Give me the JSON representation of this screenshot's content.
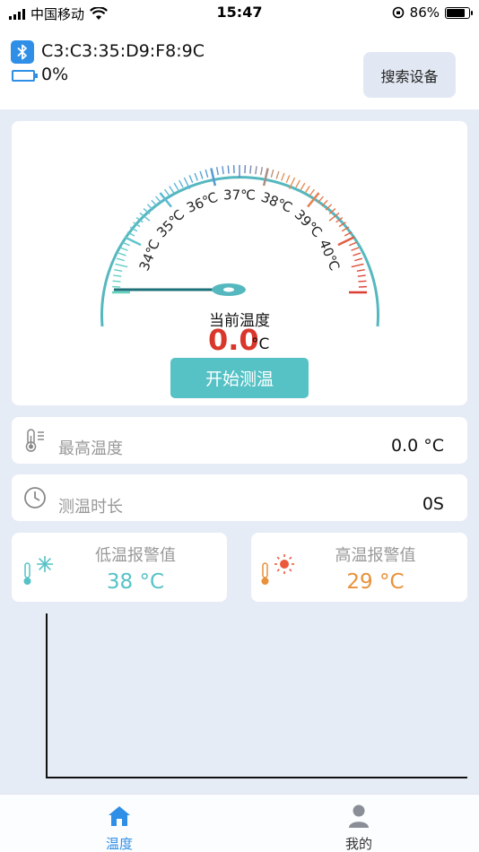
{
  "status_bar": {
    "carrier": "中国移动",
    "time": "15:47",
    "battery_pct": "86%"
  },
  "device": {
    "mac": "C3:C3:35:D9:F8:9C",
    "battery": "0%",
    "search_button": "搜索设备"
  },
  "gauge": {
    "tick_labels": [
      "34℃",
      "35℃",
      "36℃",
      "37℃",
      "38℃",
      "39℃",
      "40℃"
    ],
    "current_label": "当前温度",
    "current_value": "0.0",
    "current_unit": "°C",
    "start_button": "开始测温"
  },
  "max_temp": {
    "label": "最高温度",
    "value": "0.0 °C"
  },
  "duration": {
    "label": "测温时长",
    "value": "0S"
  },
  "low_alarm": {
    "label": "低温报警值",
    "value": "38 °C",
    "color": "#56c2c6"
  },
  "high_alarm": {
    "label": "高温报警值",
    "value": "29 °C",
    "color": "#e8913a"
  },
  "tabs": [
    {
      "label": "温度",
      "icon": "home-icon",
      "active": true,
      "color": "#2f8fe6"
    },
    {
      "label": "我的",
      "icon": "user-icon",
      "active": false,
      "color": "#333333"
    }
  ]
}
